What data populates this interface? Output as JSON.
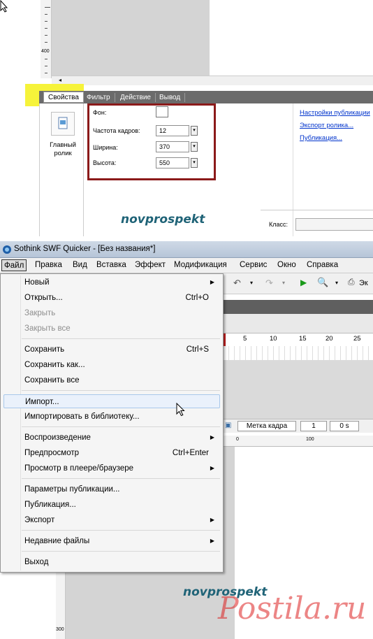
{
  "top": {
    "ruler_label": "400",
    "tabs": [
      "Свойства",
      "Фильтр",
      "Действие",
      "Вывод"
    ],
    "movie_label": "Главный ролик",
    "props": [
      {
        "label": "Фон:",
        "value": ""
      },
      {
        "label": "Частота кадров:",
        "value": "12"
      },
      {
        "label": "Ширина:",
        "value": "370"
      },
      {
        "label": "Высота:",
        "value": "550"
      }
    ],
    "links": [
      "Настройки публикации",
      "Экспорт ролика...",
      "Публикация..."
    ],
    "class_label": "Класс:",
    "watermark": "novprospekt",
    "highlight_color": "#f6f33a",
    "frame_color": "#8b1a1a"
  },
  "window": {
    "title": "Sothink SWF Quicker - [Без названия*]",
    "menubar": [
      "Файл",
      "Правка",
      "Вид",
      "Вставка",
      "Эффект",
      "Модификация",
      "Сервис",
      "Окно",
      "Справка"
    ],
    "toolbar_export": "Эк",
    "timeline_numbers": [
      "5",
      "10",
      "15",
      "20",
      "25"
    ],
    "frame_label_field": "Метка кадра",
    "frame_number": "1",
    "frame_time": "0 s",
    "ruler_marks": [
      "0",
      "100"
    ],
    "ruler_bottom": "300"
  },
  "file_menu": {
    "items": [
      {
        "label": "Новый",
        "shortcut": "",
        "submenu": true,
        "disabled": false
      },
      {
        "label": "Открыть...",
        "shortcut": "Ctrl+O",
        "submenu": false,
        "disabled": false
      },
      {
        "label": "Закрыть",
        "shortcut": "",
        "submenu": false,
        "disabled": true
      },
      {
        "label": "Закрыть все",
        "shortcut": "",
        "submenu": false,
        "disabled": true
      },
      {
        "label": "Сохранить",
        "shortcut": "Ctrl+S",
        "submenu": false,
        "disabled": false
      },
      {
        "label": "Сохранить как...",
        "shortcut": "",
        "submenu": false,
        "disabled": false
      },
      {
        "label": "Сохранить все",
        "shortcut": "",
        "submenu": false,
        "disabled": false
      },
      {
        "label": "Импорт...",
        "shortcut": "",
        "submenu": false,
        "disabled": false
      },
      {
        "label": "Импортировать в библиотеку...",
        "shortcut": "",
        "submenu": false,
        "disabled": false
      },
      {
        "label": "Воспроизведение",
        "shortcut": "",
        "submenu": true,
        "disabled": false
      },
      {
        "label": "Предпросмотр",
        "shortcut": "Ctrl+Enter",
        "submenu": false,
        "disabled": false
      },
      {
        "label": "Просмотр в плеере/браузере",
        "shortcut": "",
        "submenu": true,
        "disabled": false
      },
      {
        "label": "Параметры публикации...",
        "shortcut": "",
        "submenu": false,
        "disabled": false
      },
      {
        "label": "Публикация...",
        "shortcut": "",
        "submenu": false,
        "disabled": false
      },
      {
        "label": "Экспорт",
        "shortcut": "",
        "submenu": true,
        "disabled": false
      },
      {
        "label": "Недавние файлы",
        "shortcut": "",
        "submenu": true,
        "disabled": false
      },
      {
        "label": "Выход",
        "shortcut": "",
        "submenu": false,
        "disabled": false
      }
    ],
    "highlighted": "Импорт..."
  },
  "bottom_watermark": "novprospekt",
  "site_logo": "Postila.ru"
}
